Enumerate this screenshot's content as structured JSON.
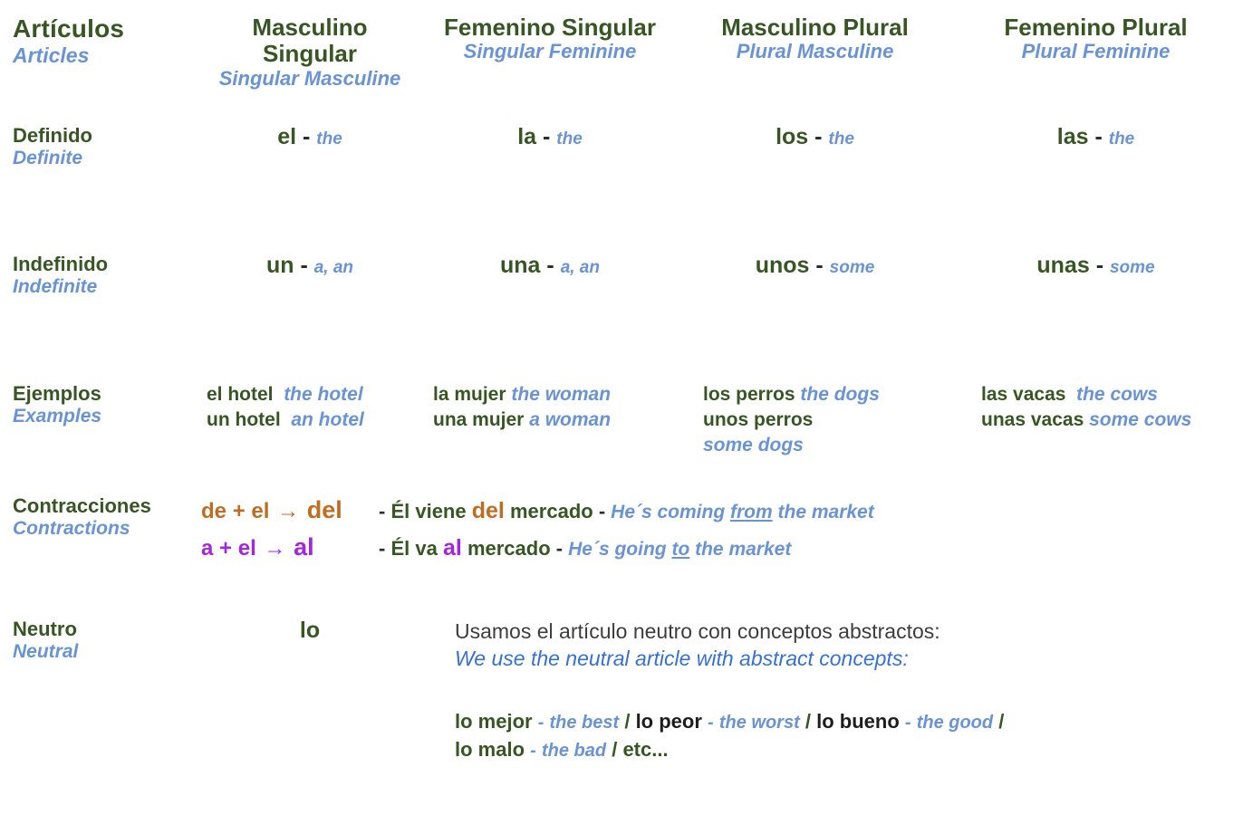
{
  "title": {
    "es": "Artículos",
    "en": "Articles"
  },
  "columns": [
    {
      "es": "Masculino Singular",
      "es_line1": "Masculino",
      "es_line2": "Singular",
      "en": "Singular Masculine"
    },
    {
      "es": "Femenino Singular",
      "en": "Singular Feminine"
    },
    {
      "es": "Masculino Plural",
      "en": "Plural Masculine"
    },
    {
      "es": "Femenino Plural",
      "en": "Plural Feminine"
    }
  ],
  "rows": {
    "definido": {
      "label_es": "Definido",
      "label_en": "Definite",
      "cells": [
        {
          "article": "el",
          "sep": "-",
          "translation": "the"
        },
        {
          "article": "la",
          "sep": "-",
          "translation": "the"
        },
        {
          "article": "los",
          "sep": "-",
          "translation": "the"
        },
        {
          "article": "las",
          "sep": "-",
          "translation": "the"
        }
      ]
    },
    "indefinido": {
      "label_es": "Indefinido",
      "label_en": "Indefinite",
      "cells": [
        {
          "article": "un",
          "sep": "-",
          "translation": "a, an"
        },
        {
          "article": "una",
          "sep": "-",
          "translation": "a, an"
        },
        {
          "article": "unos",
          "sep": "-",
          "translation": "some"
        },
        {
          "article": "unas",
          "sep": "-",
          "translation": "some"
        }
      ]
    },
    "ejemplos": {
      "label_es": "Ejemplos",
      "label_en": "Examples",
      "masculino_singular": {
        "line1_es": "el hotel",
        "line1_en": "the hotel",
        "line2_es": "un hotel",
        "line2_en": "an hotel"
      },
      "femenino_singular": {
        "line1_es": "la  mujer",
        "line1_en": "the woman",
        "line2_es": "una mujer",
        "line2_en": "a woman"
      },
      "masculino_plural": {
        "line1_es": "los perros",
        "line1_en": "the dogs",
        "line2_es": "unos perros",
        "line2_en": "some dogs"
      },
      "femenino_plural": {
        "line1_es": "las vacas",
        "line1_en": "the cows",
        "line2_es": "unas vacas",
        "line2_en": "some cows"
      }
    },
    "contracciones": {
      "label_es": "Contracciones",
      "label_en": "Contractions",
      "line1": {
        "formula_a": "de",
        "formula_plus": "+",
        "formula_b": "el",
        "formula_arrow": "→",
        "formula_result": "del",
        "dash": "-",
        "sentence_pre": "Él viene",
        "sentence_hl": "del",
        "sentence_post": "mercado",
        "dash2": "-",
        "translation_pre": "He´s coming ",
        "translation_underline": "from",
        "translation_post": " the market"
      },
      "line2": {
        "formula_a": "a",
        "formula_plus": "+",
        "formula_b": "el",
        "formula_arrow": "→",
        "formula_result": "al",
        "dash": "-",
        "sentence_pre": "Él va",
        "sentence_hl": "al",
        "sentence_post": "mercado",
        "dash2": "-",
        "translation_pre": "He´s going ",
        "translation_underline": "to",
        "translation_post": " the market"
      }
    },
    "neutro": {
      "label_es": "Neutro",
      "label_en": "Neutral",
      "article": "lo",
      "note_es": "Usamos el artículo neutro con conceptos abstractos:",
      "note_en": "We use the neutral article with abstract concepts:",
      "examples_line1": [
        {
          "es": "lo mejor",
          "dash": "-",
          "en": "the best",
          "slash": "/"
        },
        {
          "es": "lo peor",
          "dash": "-",
          "en": "the worst",
          "slash": "/"
        },
        {
          "es": "lo bueno",
          "dash": "-",
          "en": "the good",
          "slash": "/"
        }
      ],
      "examples_line2": [
        {
          "es": "lo malo",
          "dash": "-",
          "en": "the bad",
          "slash": "/"
        },
        {
          "es": "etc...",
          "dash": "",
          "en": "",
          "slash": ""
        }
      ]
    }
  },
  "colors": {
    "spanish_green": "#375623",
    "english_blue": "#6a93d4",
    "contraction_del": "#bf6d22",
    "contraction_al": "#a226e0",
    "note_gray": "#3d3d3d",
    "note_blue": "#3670d1"
  }
}
